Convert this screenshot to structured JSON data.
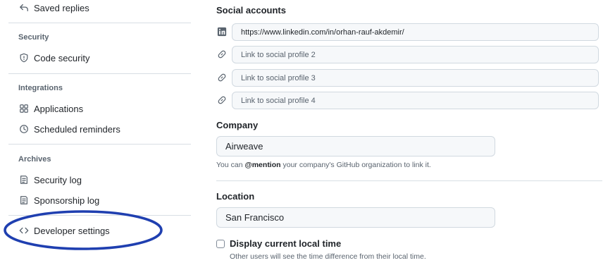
{
  "sidebar": {
    "saved_replies": "Saved replies",
    "security_heading": "Security",
    "code_security": "Code security",
    "integrations_heading": "Integrations",
    "applications": "Applications",
    "scheduled_reminders": "Scheduled reminders",
    "archives_heading": "Archives",
    "security_log": "Security log",
    "sponsorship_log": "Sponsorship log",
    "developer_settings": "Developer settings"
  },
  "profile": {
    "social_heading": "Social accounts",
    "social_links": [
      {
        "icon": "linkedin-icon",
        "value": "https://www.linkedin.com/in/orhan-rauf-akdemir/",
        "placeholder": ""
      },
      {
        "icon": "link-icon",
        "value": "",
        "placeholder": "Link to social profile 2"
      },
      {
        "icon": "link-icon",
        "value": "",
        "placeholder": "Link to social profile 3"
      },
      {
        "icon": "link-icon",
        "value": "",
        "placeholder": "Link to social profile 4"
      }
    ],
    "company_heading": "Company",
    "company_value": "Airweave",
    "company_note_prefix": "You can ",
    "company_note_mention": "@mention",
    "company_note_suffix": " your company's GitHub organization to link it.",
    "location_heading": "Location",
    "location_value": "San Francisco",
    "display_time_label": "Display current local time",
    "display_time_checked": false,
    "display_time_note": "Other users will see the time difference from their local time."
  },
  "colors": {
    "annotation": "#1f3fb0",
    "linkedin": "#0a66c2",
    "border": "#d1d9e0"
  }
}
